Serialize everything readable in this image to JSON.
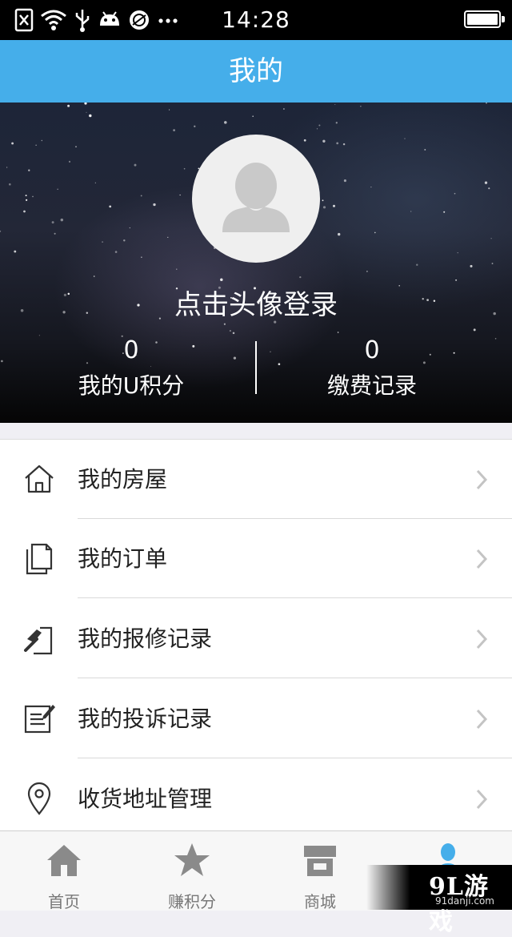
{
  "status_bar": {
    "time": "14:28",
    "battery_level": 1.0,
    "icons": [
      "sim-off-icon",
      "wifi-icon",
      "usb-icon",
      "android-icon",
      "app-icon",
      "more-icon"
    ]
  },
  "header": {
    "title": "我的"
  },
  "profile": {
    "login_prompt": "点击头像登录",
    "stats": [
      {
        "value": "0",
        "label": "我的U积分"
      },
      {
        "value": "0",
        "label": "缴费记录"
      }
    ]
  },
  "menu": {
    "items": [
      {
        "label": "我的房屋",
        "icon": "house-icon"
      },
      {
        "label": "我的订单",
        "icon": "document-icon"
      },
      {
        "label": "我的报修记录",
        "icon": "hammer-icon"
      },
      {
        "label": "我的投诉记录",
        "icon": "edit-note-icon"
      },
      {
        "label": "收货地址管理",
        "icon": "location-pin-icon"
      }
    ]
  },
  "tabbar": {
    "tabs": [
      {
        "label": "首页",
        "icon": "home-icon"
      },
      {
        "label": "赚积分",
        "icon": "star-icon"
      },
      {
        "label": "商城",
        "icon": "store-icon"
      },
      {
        "label": "",
        "icon": "person-icon"
      }
    ],
    "active_color": "#45aeea",
    "inactive_color": "#777777"
  },
  "watermark": {
    "logo": "9L游戏",
    "url": "91danji.com"
  },
  "colors": {
    "accent": "#45aeea",
    "hero_dark": "#050505"
  }
}
